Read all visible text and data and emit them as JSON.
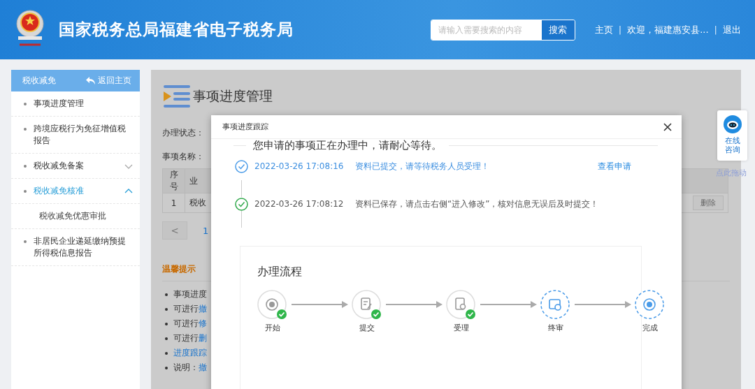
{
  "header": {
    "title": "国家税务总局福建省电子税务局",
    "search": {
      "placeholder": "请输入需要搜索的内容",
      "button": "搜索"
    },
    "links": [
      "主页",
      "欢迎，福建惠安县...",
      "退出"
    ],
    "separator": "|"
  },
  "sidebar": {
    "title": "税收减免",
    "back": "返回主页",
    "items": [
      {
        "label": "事项进度管理",
        "selected": false
      },
      {
        "label": "跨境应税行为免征增值税报告",
        "selected": false
      },
      {
        "label": "税收减免备案",
        "selected": false,
        "expanded": false
      },
      {
        "label": "税收减免核准",
        "selected": true,
        "expanded": true,
        "children": [
          {
            "label": "税收减免优惠审批"
          }
        ]
      },
      {
        "label": "非居民企业递延缴纳预提所得税信息报告",
        "selected": false
      }
    ]
  },
  "page": {
    "title": "事项进度管理",
    "filters": [
      "办理状态：",
      "事项名称："
    ],
    "table": {
      "columns": [
        "序号",
        "业"
      ],
      "rows": [
        [
          "1",
          "税收"
        ]
      ],
      "row_action": "删除"
    },
    "pagination": {
      "prev": "<",
      "page": "1"
    },
    "tips": {
      "title": "温馨提示",
      "items": [
        {
          "text": "事项进度"
        },
        {
          "text": "可进行",
          "link": "撤"
        },
        {
          "text": "可进行",
          "link": "修"
        },
        {
          "text": "可进行",
          "link": "删"
        },
        {
          "link": "进度跟踪"
        },
        {
          "text": "说明：",
          "link": "撤"
        }
      ]
    }
  },
  "chat_widget": {
    "label": "在线咨询",
    "drag_hint": "点此拖动"
  },
  "modal": {
    "title": "事项进度跟踪",
    "headline": "您申请的事项正在办理中，请耐心等待。",
    "timeline": [
      {
        "time": "2022-03-26 17:08:16",
        "message": "资料已提交，请等待税务人员受理！",
        "action": "查看申请",
        "current": true
      },
      {
        "time": "2022-03-26 17:08:12",
        "message": "资料已保存，请点击右侧“进入修改”，核对信息无误后及时提交！",
        "current": false
      }
    ],
    "process": {
      "title": "办理流程",
      "steps": [
        {
          "label": "开始",
          "kind": "start",
          "done": true
        },
        {
          "label": "提交",
          "kind": "submit",
          "done": true
        },
        {
          "label": "受理",
          "kind": "accept",
          "done": true
        },
        {
          "label": "终审",
          "kind": "review",
          "done": false
        },
        {
          "label": "完成",
          "kind": "finish",
          "done": false
        }
      ]
    }
  }
}
